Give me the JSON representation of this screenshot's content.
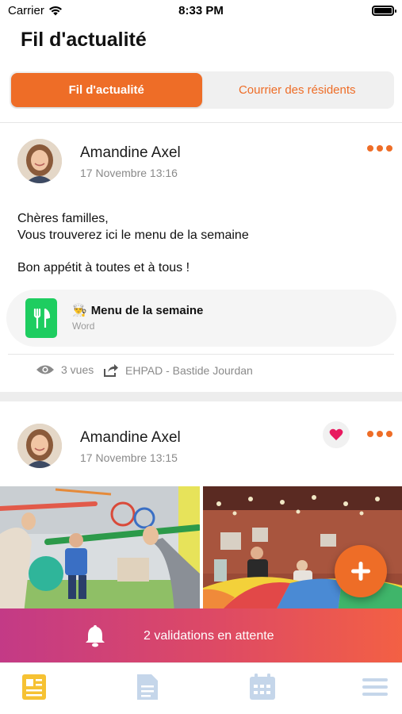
{
  "status_bar": {
    "carrier": "Carrier",
    "time": "8:33 PM"
  },
  "page_title": "Fil d'actualité",
  "segments": [
    {
      "label": "Fil d'actualité",
      "active": true
    },
    {
      "label": "Courrier des résidents",
      "active": false
    }
  ],
  "posts": [
    {
      "author": "Amandine Axel",
      "date": "17 Novembre 13:16",
      "text_lines": [
        "Chères familles,",
        "Vous trouverez ici le menu de la semaine"
      ],
      "text_closing": "Bon appétit à toutes et à tous !",
      "attachment": {
        "emoji": "👨‍🍳",
        "title": "Menu de la semaine",
        "type": "Word"
      },
      "views": "3 vues",
      "shared_to": "EHPAD - Bastide Jourdan"
    },
    {
      "author": "Amandine Axel",
      "date": "17 Novembre 13:15",
      "liked": true
    }
  ],
  "banner": {
    "text": "2 validations en attente"
  },
  "tab_bar": {
    "items": [
      {
        "icon": "newspaper-icon",
        "active": true
      },
      {
        "icon": "document-icon",
        "active": false
      },
      {
        "icon": "calendar-icon",
        "active": false
      },
      {
        "icon": "menu-icon",
        "active": false
      }
    ]
  },
  "colors": {
    "accent": "#ee6d27",
    "banner_gradient_start": "#c33a86",
    "banner_gradient_end": "#f36044",
    "attachment_icon": "#1ecd60",
    "like": "#e8195f",
    "tab_active": "#f6c233",
    "tab_inactive": "#c5d6ea"
  }
}
